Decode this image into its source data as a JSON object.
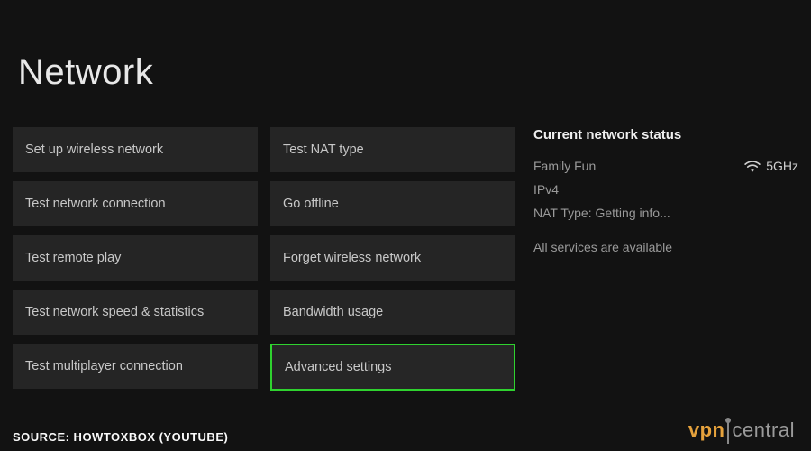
{
  "page": {
    "title": "Network"
  },
  "columns": [
    {
      "items": [
        {
          "label": "Set up wireless network",
          "selected": false
        },
        {
          "label": "Test network connection",
          "selected": false
        },
        {
          "label": "Test remote play",
          "selected": false
        },
        {
          "label": "Test network speed & statistics",
          "selected": false
        },
        {
          "label": "Test multiplayer connection",
          "selected": false
        }
      ]
    },
    {
      "items": [
        {
          "label": "Test NAT type",
          "selected": false
        },
        {
          "label": "Go offline",
          "selected": false
        },
        {
          "label": "Forget wireless network",
          "selected": false
        },
        {
          "label": "Bandwidth usage",
          "selected": false
        },
        {
          "label": "Advanced settings",
          "selected": true
        }
      ]
    }
  ],
  "status": {
    "title": "Current network status",
    "network_name": "Family Fun",
    "band": "5GHz",
    "ip_version": "IPv4",
    "nat_line": "NAT Type: Getting info...",
    "services_line": "All services are available"
  },
  "footer": {
    "source": "SOURCE: HOWTOXBOX (YOUTUBE)",
    "brand_left": "vpn",
    "brand_right": "central"
  },
  "icons": {
    "wifi": "wifi-icon"
  }
}
